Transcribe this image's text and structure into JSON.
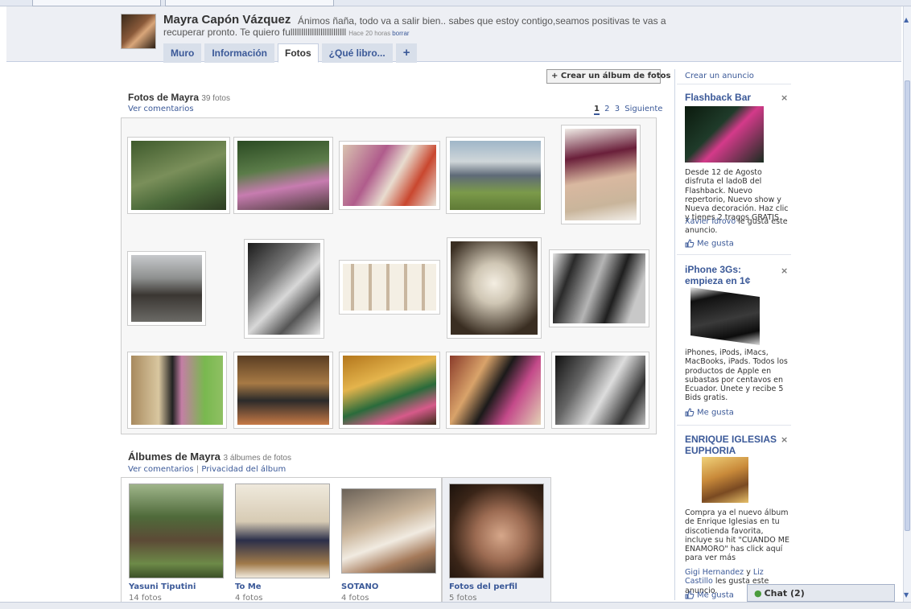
{
  "profile": {
    "name": "Mayra Capón Vázquez",
    "status_line1": "Ánimos ñaña, todo va a salir bien.. sabes que estoy contigo,seamos positivas te vas a",
    "status_line2": "recuperar pronto. Te quiero fullllllllllllllllllllllllll",
    "status_time": "Hace 20 horas",
    "status_delete": "borrar"
  },
  "tabs": [
    {
      "label": "Muro"
    },
    {
      "label": "Información"
    },
    {
      "label": "Fotos"
    },
    {
      "label": "¿Qué libro..."
    },
    {
      "label": "+"
    }
  ],
  "active_tab": "Fotos",
  "photos": {
    "create_album": "+ Crear un álbum de fotos",
    "title": "Fotos de Mayra",
    "count": "39 fotos",
    "view_comments": "Ver comentarios",
    "pager": [
      "1",
      "2",
      "3",
      "Siguiente"
    ]
  },
  "albums": {
    "title": "Álbumes de Mayra",
    "count": "3 álbumes de fotos",
    "view_comments": "Ver comentarios",
    "separator": "|",
    "privacy": "Privacidad del álbum",
    "items": [
      {
        "name": "Yasuni Tiputini",
        "count": "14 fotos"
      },
      {
        "name": "To Me",
        "count": "4 fotos"
      },
      {
        "name": "SOTANO",
        "count": "4 fotos"
      },
      {
        "name": "Fotos del perfil",
        "count": "5 fotos"
      }
    ]
  },
  "sidebar": {
    "create_ad": "Crear un anuncio",
    "ads": [
      {
        "title": "Flashback Bar",
        "close": "×",
        "text": "Desde 12 de Agosto disfruta el ladoB del Flashback. Nuevo repertorio, Nuevo show y Nueva decoración. Haz clic y tienes 2 tragos GRATIS",
        "social_user": "Xavier Idrovo",
        "social_text": "le gusta este anuncio.",
        "like": "Me gusta"
      },
      {
        "title": "iPhone 3Gs: empieza en 1¢",
        "close": "×",
        "text": "iPhones, iPods, iMacs, MacBooks, iPads. Todos los productos de Apple en subastas por centavos en Ecuador. Únete y recibe 5 Bids gratis.",
        "like": "Me gusta"
      },
      {
        "title": "ENRIQUE IGLESIAS EUPHORIA",
        "close": "×",
        "text": "Compra ya el nuevo álbum de Enrique Iglesias en tu discotienda favorita, incluye su hit \"CUANDO ME ENAMORO\" has click aquí para ver más",
        "social_user1": "Gigi Hernandez",
        "social_and": "y",
        "social_user2": "Liz Castillo",
        "social_text": "les gusta este anuncio.",
        "like": "Me gusta"
      }
    ]
  },
  "chat": {
    "label": "Chat (2)"
  },
  "colors": {
    "link": "#3b5998",
    "header_bg": "#edeff4",
    "tab_bg": "#d8dfea"
  }
}
